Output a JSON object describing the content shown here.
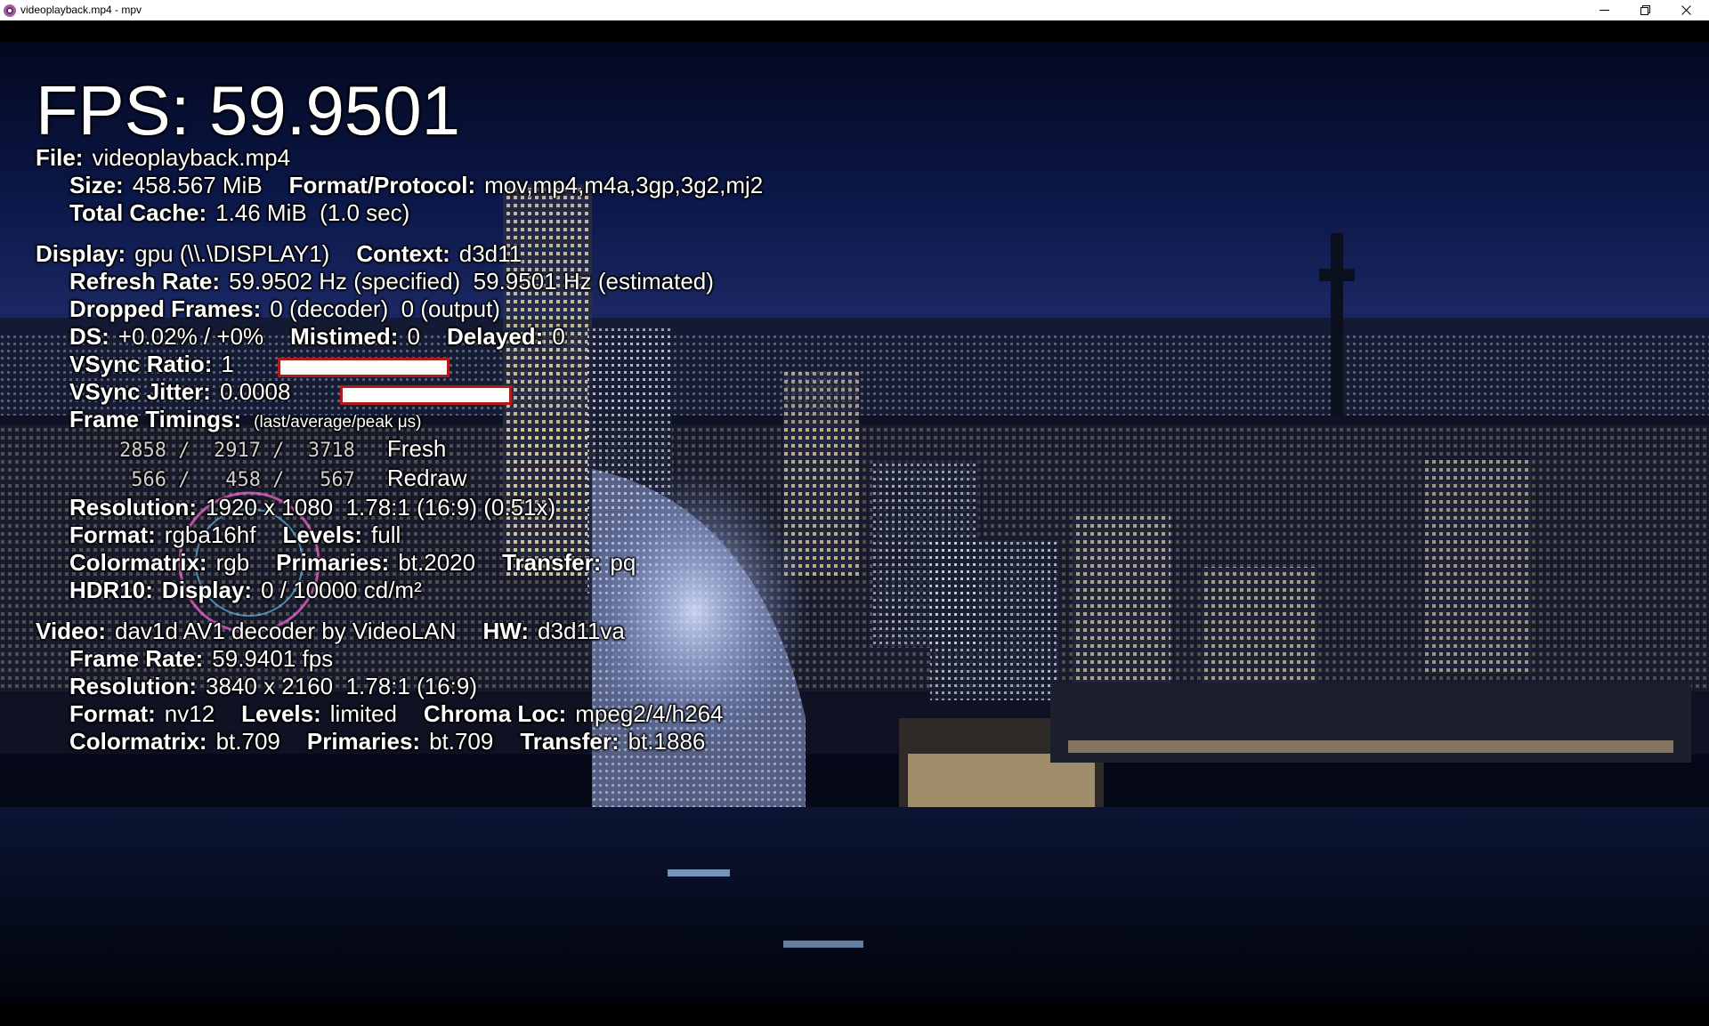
{
  "window": {
    "title": "videoplayback.mp4 - mpv",
    "controls": {
      "minimize_icon": "minimize-icon",
      "maximize_icon": "restore-icon",
      "close_icon": "close-icon"
    }
  },
  "stats": {
    "fps": "FPS: 59.9501",
    "file": {
      "label": "File:",
      "value": "videoplayback.mp4"
    },
    "size": {
      "label": "Size:",
      "value": "458.567 MiB"
    },
    "format_protocol": {
      "label": "Format/Protocol:",
      "value": "mov,mp4,m4a,3gp,3g2,mj2"
    },
    "total_cache": {
      "label": "Total Cache:",
      "value": "1.46 MiB  (1.0 sec)"
    },
    "display": {
      "label": "Display:",
      "value": "gpu (\\\\.\\DISPLAY1)"
    },
    "context": {
      "label": "Context:",
      "value": "d3d11"
    },
    "refresh_rate": {
      "label": "Refresh Rate:",
      "value": "59.9502 Hz (specified)  59.9501 Hz (estimated)"
    },
    "dropped_frames": {
      "label": "Dropped Frames:",
      "value": "0 (decoder)  0 (output)"
    },
    "ds": {
      "label": "DS:",
      "value": "+0.02% / +0%"
    },
    "mistimed": {
      "label": "Mistimed:",
      "value": "0"
    },
    "delayed": {
      "label": "Delayed:",
      "value": "0"
    },
    "vsync_ratio": {
      "label": "VSync Ratio:",
      "value": "1"
    },
    "vsync_jitter": {
      "label": "VSync Jitter:",
      "value": "0.0008"
    },
    "frame_timings": {
      "label": "Frame Timings:",
      "note": "(last/average/peak μs)"
    },
    "timings": [
      {
        "values": "2858 /  2917 /  3718",
        "name": "Fresh"
      },
      {
        "values": " 566 /   458 /   567",
        "name": "Redraw"
      }
    ],
    "out_resolution": {
      "label": "Resolution:",
      "value": "1920 x 1080  1.78:1 (16:9) (0.51x)"
    },
    "out_format": {
      "label": "Format:",
      "value": "rgba16hf"
    },
    "out_levels": {
      "label": "Levels:",
      "value": "full"
    },
    "out_colormatrix": {
      "label": "Colormatrix:",
      "value": "rgb"
    },
    "out_primaries": {
      "label": "Primaries:",
      "value": "bt.2020"
    },
    "out_transfer": {
      "label": "Transfer:",
      "value": "pq"
    },
    "hdr10": {
      "label": "HDR10:",
      "sublabel": "Display:",
      "value": "0 / 10000 cd/m²"
    },
    "video": {
      "label": "Video:",
      "value": "dav1d AV1 decoder by VideoLAN"
    },
    "hw": {
      "label": "HW:",
      "value": "d3d11va"
    },
    "frame_rate": {
      "label": "Frame Rate:",
      "value": "59.9401 fps"
    },
    "vid_resolution": {
      "label": "Resolution:",
      "value": "3840 x 2160  1.78:1 (16:9)"
    },
    "vid_format": {
      "label": "Format:",
      "value": "nv12"
    },
    "vid_levels": {
      "label": "Levels:",
      "value": "limited"
    },
    "chroma_loc": {
      "label": "Chroma Loc:",
      "value": "mpeg2/4/h264"
    },
    "vid_colormatrix": {
      "label": "Colormatrix:",
      "value": "bt.709"
    },
    "vid_primaries": {
      "label": "Primaries:",
      "value": "bt.709"
    },
    "vid_transfer": {
      "label": "Transfer:",
      "value": "bt.1886"
    }
  },
  "colors": {
    "graph_border": "#b11a1a",
    "graph_fill": "#ffffff",
    "titlebar": "#ffffff",
    "overlay_text": "#ffffff"
  }
}
